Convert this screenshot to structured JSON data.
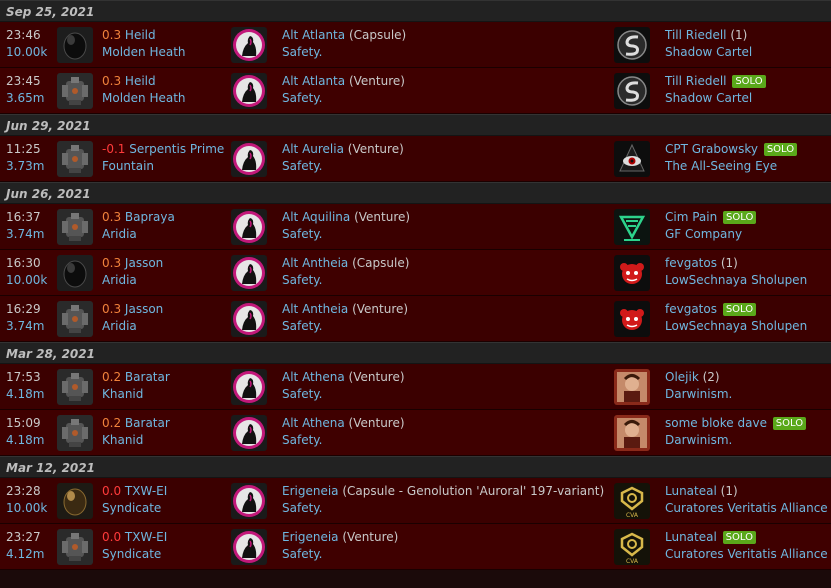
{
  "groups": [
    {
      "date": "Sep 25, 2021",
      "kills": [
        {
          "time": "23:46",
          "value": "10.00k",
          "ship_icon": "capsule-icon",
          "sec": "0.3",
          "system": "Heild",
          "region": "Molden Heath",
          "victim_name": "Alt Atlanta",
          "victim_ship": "(Capsule)",
          "victim_corp": "Safety.",
          "killer_icon": "shadow-cartel-logo-icon",
          "killer_name": "Till Riedell",
          "killer_count": "(1)",
          "killer_solo": "",
          "killer_corp": "Shadow Cartel"
        },
        {
          "time": "23:45",
          "value": "3.65m",
          "ship_icon": "venture-icon",
          "sec": "0.3",
          "system": "Heild",
          "region": "Molden Heath",
          "victim_name": "Alt Atlanta",
          "victim_ship": "(Venture)",
          "victim_corp": "Safety.",
          "killer_icon": "shadow-cartel-logo-icon",
          "killer_name": "Till Riedell",
          "killer_count": "",
          "killer_solo": "SOLO",
          "killer_corp": "Shadow Cartel"
        }
      ]
    },
    {
      "date": "Jun 29, 2021",
      "kills": [
        {
          "time": "11:25",
          "value": "3.73m",
          "ship_icon": "venture-icon",
          "sec": "-0.1",
          "system": "Serpentis Prime",
          "region": "Fountain",
          "victim_name": "Alt Aurelia",
          "victim_ship": "(Venture)",
          "victim_corp": "Safety.",
          "killer_icon": "all-seeing-eye-logo-icon",
          "killer_name": "CPT Grabowsky",
          "killer_count": "",
          "killer_solo": "SOLO",
          "killer_corp": "The All-Seeing Eye"
        }
      ]
    },
    {
      "date": "Jun 26, 2021",
      "kills": [
        {
          "time": "16:37",
          "value": "3.74m",
          "ship_icon": "venture-icon",
          "sec": "0.3",
          "system": "Bapraya",
          "region": "Aridia",
          "victim_name": "Alt Aquilina",
          "victim_ship": "(Venture)",
          "victim_corp": "Safety.",
          "killer_icon": "gf-company-logo-icon",
          "killer_name": "Cim Pain",
          "killer_count": "",
          "killer_solo": "SOLO",
          "killer_corp": "GF Company"
        },
        {
          "time": "16:30",
          "value": "10.00k",
          "ship_icon": "capsule-icon",
          "sec": "0.3",
          "system": "Jasson",
          "region": "Aridia",
          "victim_name": "Alt Antheia",
          "victim_ship": "(Capsule)",
          "victim_corp": "Safety.",
          "killer_icon": "lowsechnaya-logo-icon",
          "killer_name": "fevgatos",
          "killer_count": "(1)",
          "killer_solo": "",
          "killer_corp": "LowSechnaya Sholupen"
        },
        {
          "time": "16:29",
          "value": "3.74m",
          "ship_icon": "venture-icon",
          "sec": "0.3",
          "system": "Jasson",
          "region": "Aridia",
          "victim_name": "Alt Antheia",
          "victim_ship": "(Venture)",
          "victim_corp": "Safety.",
          "killer_icon": "lowsechnaya-logo-icon",
          "killer_name": "fevgatos",
          "killer_count": "",
          "killer_solo": "SOLO",
          "killer_corp": "LowSechnaya Sholupen"
        }
      ]
    },
    {
      "date": "Mar 28, 2021",
      "kills": [
        {
          "time": "17:53",
          "value": "4.18m",
          "ship_icon": "venture-icon",
          "sec": "0.2",
          "system": "Baratar",
          "region": "Khanid",
          "victim_name": "Alt Athena",
          "victim_ship": "(Venture)",
          "victim_corp": "Safety.",
          "killer_icon": "darwinism-portrait-icon",
          "killer_name": "Olejik",
          "killer_count": "(2)",
          "killer_solo": "",
          "killer_corp": "Darwinism."
        },
        {
          "time": "15:09",
          "value": "4.18m",
          "ship_icon": "venture-icon",
          "sec": "0.2",
          "system": "Baratar",
          "region": "Khanid",
          "victim_name": "Alt Athena",
          "victim_ship": "(Venture)",
          "victim_corp": "Safety.",
          "killer_icon": "darwinism-portrait-icon",
          "killer_name": "some bloke dave",
          "killer_count": "",
          "killer_solo": "SOLO",
          "killer_corp": "Darwinism."
        }
      ]
    },
    {
      "date": "Mar 12, 2021",
      "kills": [
        {
          "time": "23:28",
          "value": "10.00k",
          "ship_icon": "genolution-capsule-icon",
          "sec": "0.0",
          "system": "TXW-EI",
          "region": "Syndicate",
          "victim_name": "Erigeneia",
          "victim_ship": "(Capsule - Genolution 'Auroral' 197-variant)",
          "victim_corp": "Safety.",
          "killer_icon": "cva-logo-icon",
          "killer_name": "Lunateal",
          "killer_count": "(1)",
          "killer_solo": "",
          "killer_corp": "Curatores Veritatis Alliance"
        },
        {
          "time": "23:27",
          "value": "4.12m",
          "ship_icon": "venture-icon",
          "sec": "0.0",
          "system": "TXW-EI",
          "region": "Syndicate",
          "victim_name": "Erigeneia",
          "victim_ship": "(Venture)",
          "victim_corp": "Safety.",
          "killer_icon": "cva-logo-icon",
          "killer_name": "Lunateal",
          "killer_count": "",
          "killer_solo": "SOLO",
          "killer_corp": "Curatores Veritatis Alliance"
        }
      ]
    }
  ],
  "colors": {
    "sec_hi": "#f0823c",
    "sec_neg": "#ff3b3b",
    "link": "#6fb7e0",
    "solo_badge": "#5aa81a",
    "row_bg": "#3b0000",
    "date_bg": "#222222"
  }
}
